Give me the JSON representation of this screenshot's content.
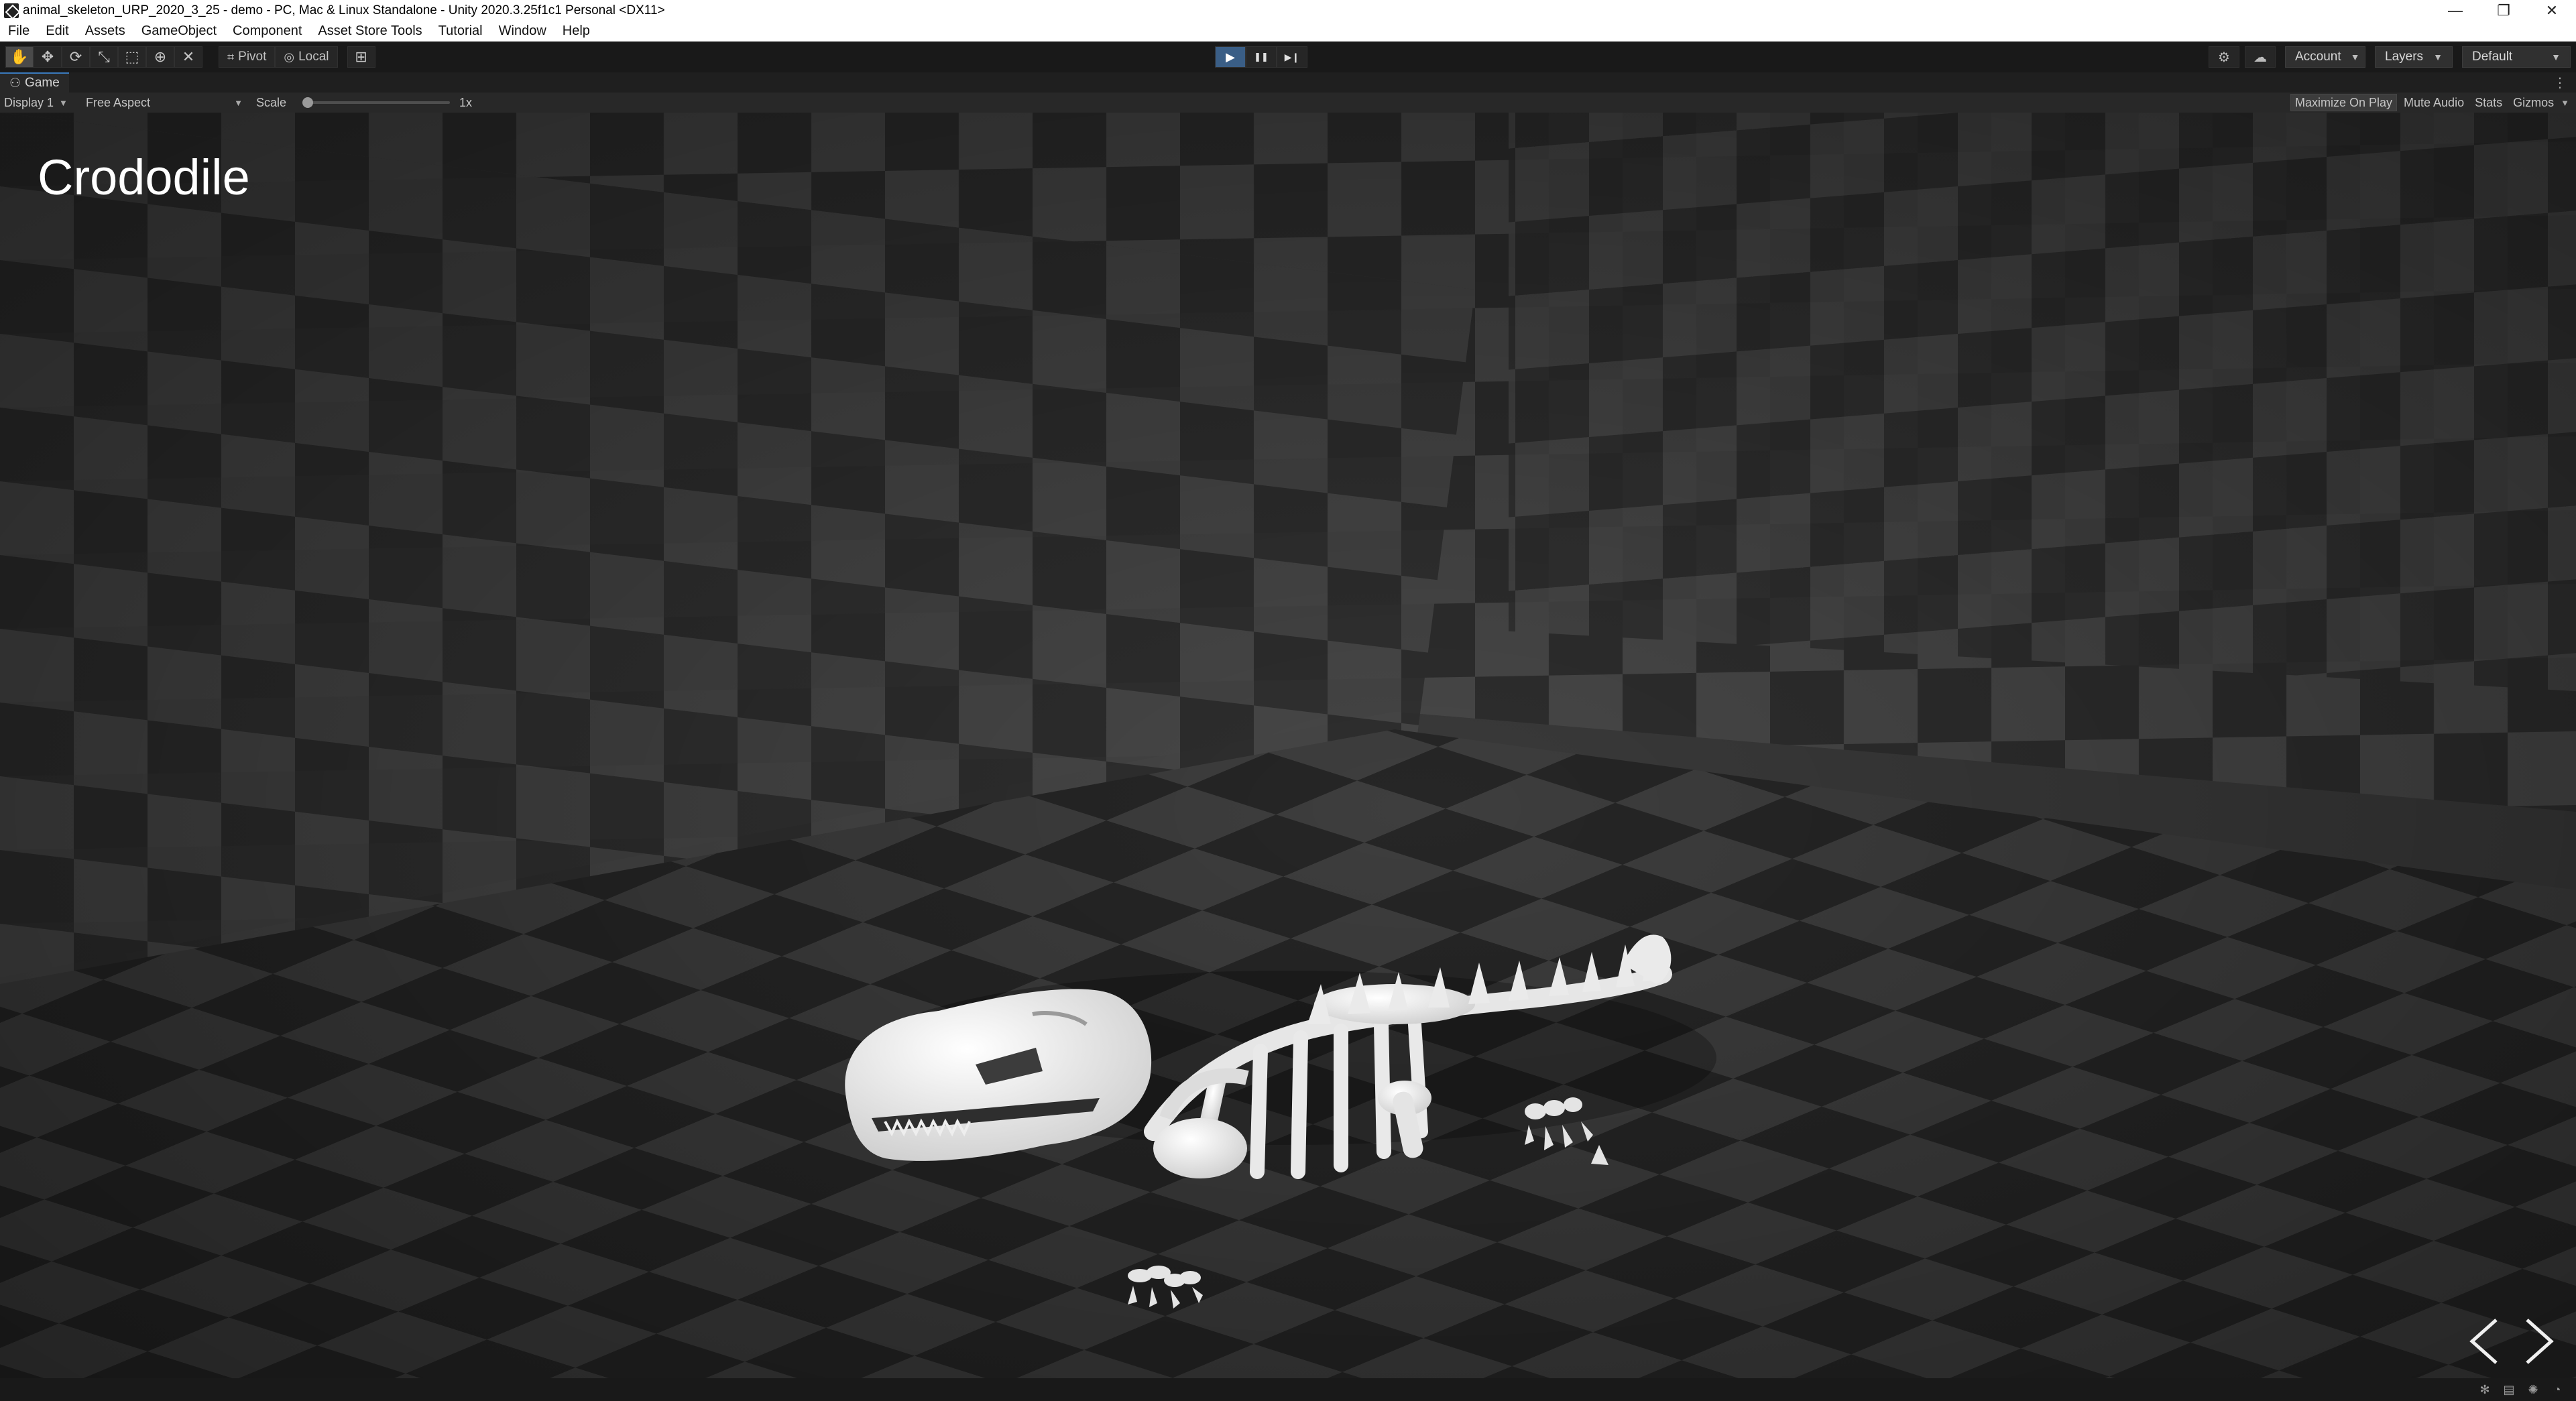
{
  "window": {
    "title": "animal_skeleton_URP_2020_3_25 - demo - PC, Mac & Linux Standalone - Unity 2020.3.25f1c1 Personal <DX11>",
    "minimize_glyph": "—",
    "maximize_glyph": "❐",
    "close_glyph": "✕"
  },
  "menu": {
    "items": [
      "File",
      "Edit",
      "Assets",
      "GameObject",
      "Component",
      "Asset Store Tools",
      "Tutorial",
      "Window",
      "Help"
    ]
  },
  "toolbar": {
    "tools": [
      {
        "name": "hand-tool",
        "icon": "hand-icon",
        "glyph": "✋",
        "active": true
      },
      {
        "name": "move-tool",
        "icon": "move-icon",
        "glyph": "✥",
        "active": false
      },
      {
        "name": "rotate-tool",
        "icon": "rotate-icon",
        "glyph": "⟳",
        "active": false
      },
      {
        "name": "scale-tool",
        "icon": "scale-icon",
        "glyph": "⤡",
        "active": false
      },
      {
        "name": "rect-tool",
        "icon": "rect-icon",
        "glyph": "⬚",
        "active": false
      },
      {
        "name": "transform-tool",
        "icon": "transform-icon",
        "glyph": "⊕",
        "active": false
      },
      {
        "name": "custom-tool",
        "icon": "custom-tool-icon",
        "glyph": "✕",
        "active": false
      }
    ],
    "pivot_label": "Pivot",
    "local_label": "Local",
    "grid_snap_glyph": "⊞",
    "play_glyph": "▶",
    "pause_glyph": "❚❚",
    "step_glyph": "▶❙",
    "playing": true,
    "cloud_glyph": "☁",
    "collab_glyph": "⚙",
    "account_label": "Account",
    "layers_label": "Layers",
    "layout_label": "Default",
    "dropdown_arrow": "▼"
  },
  "game_view": {
    "tab_label": "Game",
    "tab_icon_glyph": "👾",
    "tab_menu_glyph": "⋮",
    "display_label": "Display 1",
    "aspect_label": "Free Aspect",
    "scale_label": "Scale",
    "scale_value": "1x",
    "scale_fraction": 0.0,
    "maximize_on_play": "Maximize On Play",
    "mute_audio": "Mute Audio",
    "stats": "Stats",
    "gizmos": "Gizmos",
    "maximize_on_play_enabled": true
  },
  "scene": {
    "title": "Crododile",
    "prev_glyph": "<",
    "next_glyph": ">"
  },
  "status": {
    "icons": [
      "bug-icon",
      "console-icon",
      "lighting-icon",
      "progress-icon"
    ]
  },
  "colors": {
    "accent": "#3a5e86",
    "editor_bg": "#191919",
    "checker_light": "#4a4a4a",
    "checker_dark": "#2c2c2c",
    "bone": "#e8e8e8"
  }
}
